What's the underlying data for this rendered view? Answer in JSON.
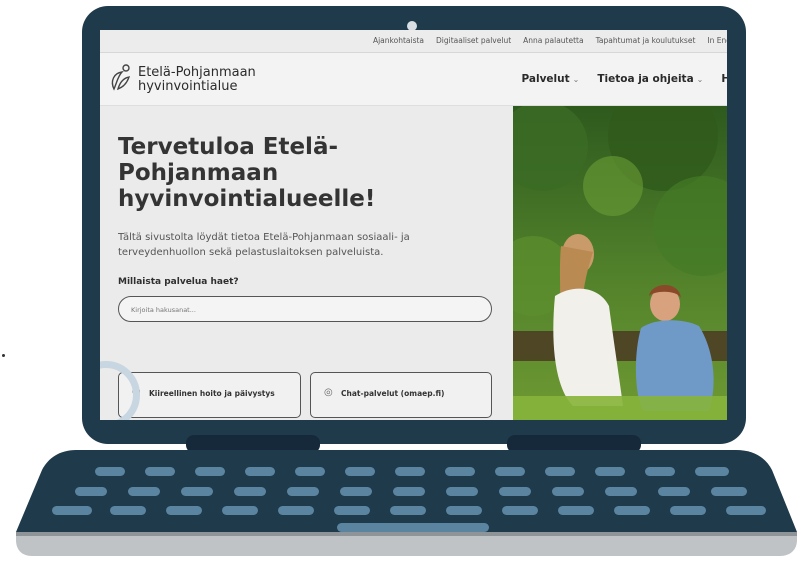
{
  "topbar": {
    "links": [
      "Ajankohtaista",
      "Digitaaliset palvelut",
      "Anna palautetta",
      "Tapahtumat ja koulutukset",
      "In Eng"
    ]
  },
  "header": {
    "logo_line1": "Etelä-Pohjanmaan",
    "logo_line2": "hyvinvointialue",
    "nav": [
      {
        "label": "Palvelut",
        "icon": "chevron-down-icon"
      },
      {
        "label": "Tietoa ja ohjeita",
        "icon": "chevron-down-icon"
      },
      {
        "label": "Hy"
      }
    ]
  },
  "hero": {
    "title": "Tervetuloa Etelä-Pohjanmaan hyvinvointialueelle!",
    "subtitle": "Tältä sivustolta löydät tietoa Etelä-Pohjanmaan sosiaali- ja terveydenhuollon sekä pelastuslaitoksen palveluista.",
    "search_label": "Millaista palvelua haet?",
    "search_placeholder": "Kirjoita hakusanat..."
  },
  "cards": [
    {
      "label": "Kiireellinen hoito ja päivystys",
      "icon": "phone-icon"
    },
    {
      "label": "Chat-palvelut (omaep.fi)",
      "icon": "chat-icon"
    }
  ],
  "colors": {
    "laptop_frame": "#1f3a4a",
    "keyboard_keys": "#5a84a0",
    "accent_arc": "#c8d6e1"
  }
}
